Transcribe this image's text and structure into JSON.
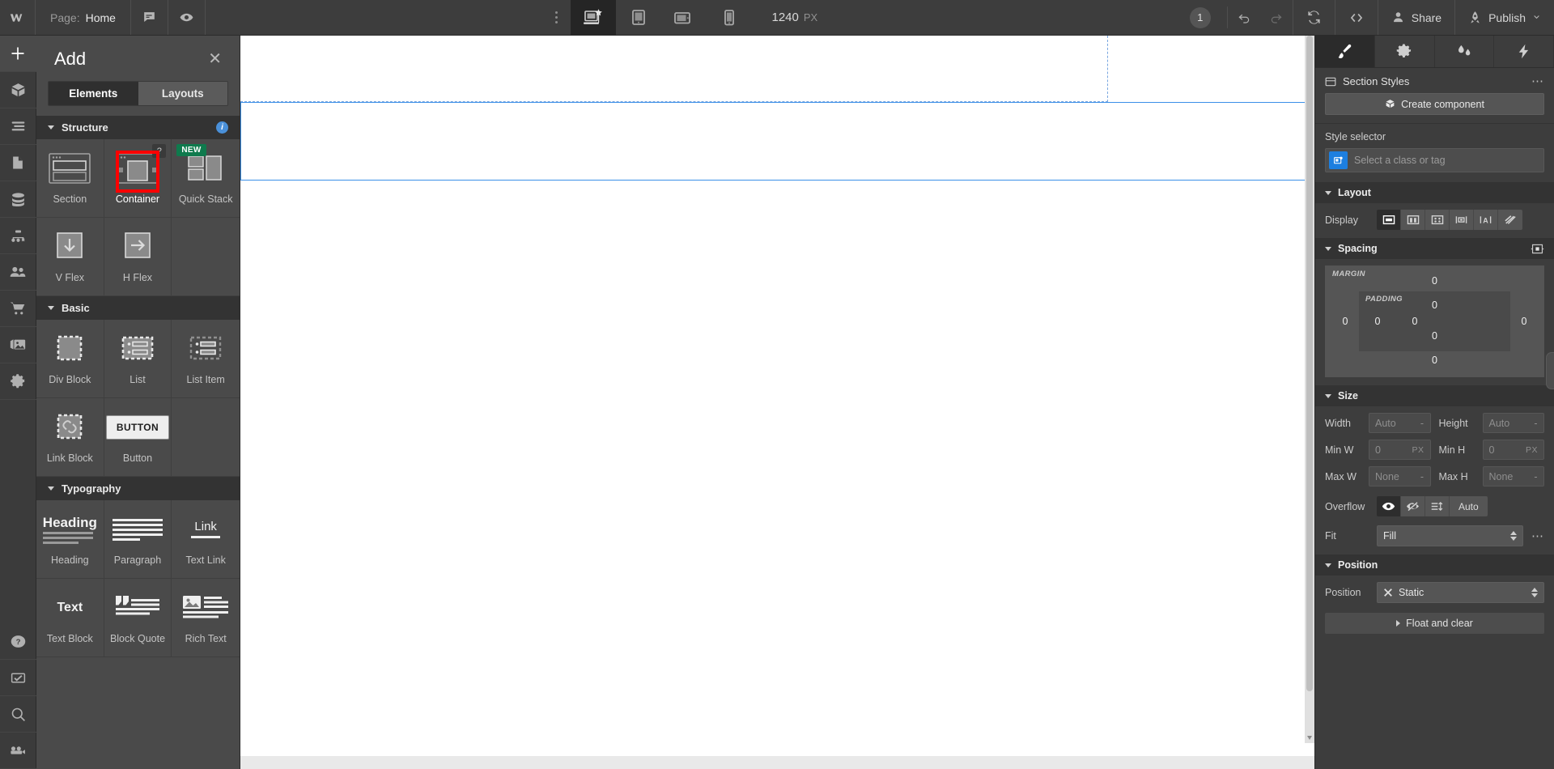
{
  "topbar": {
    "logo": "webflow-logo",
    "page_label": "Page:",
    "page_value": "Home",
    "comment_icon": "comment-icon",
    "preview_icon": "eye-icon",
    "breakpoints": [
      {
        "name": "desktop-base",
        "icon": "desktop-star-icon",
        "active": true
      },
      {
        "name": "tablet",
        "icon": "tablet-icon",
        "active": false
      },
      {
        "name": "mobile-landscape",
        "icon": "mobile-landscape-icon",
        "active": false
      },
      {
        "name": "mobile-portrait",
        "icon": "mobile-portrait-icon",
        "active": false
      }
    ],
    "viewport_width": "1240",
    "viewport_unit": "PX",
    "session_count": "1",
    "undo_icon": "undo-icon",
    "redo_icon": "redo-icon",
    "sync_icon": "refresh-icon",
    "code_icon": "code-brackets-icon",
    "share_label": "Share",
    "publish_label": "Publish"
  },
  "rail": {
    "items": [
      {
        "name": "add-panel",
        "icon": "plus-icon",
        "active": true
      },
      {
        "name": "components",
        "icon": "cube-icon",
        "active": false
      },
      {
        "name": "navigator",
        "icon": "layers-icon",
        "active": false
      },
      {
        "name": "pages",
        "icon": "page-icon",
        "active": false
      },
      {
        "name": "cms",
        "icon": "database-icon",
        "active": false
      },
      {
        "name": "logic",
        "icon": "flow-icon",
        "active": false
      },
      {
        "name": "users",
        "icon": "users-icon",
        "active": false
      },
      {
        "name": "ecommerce",
        "icon": "cart-icon",
        "active": false
      },
      {
        "name": "assets",
        "icon": "images-icon",
        "active": false
      },
      {
        "name": "settings",
        "icon": "gear-icon",
        "active": false
      }
    ],
    "bottom_items": [
      {
        "name": "help",
        "icon": "question-circle-icon"
      },
      {
        "name": "audit",
        "icon": "checkbox-icon"
      },
      {
        "name": "search",
        "icon": "magnifier-icon"
      },
      {
        "name": "video",
        "icon": "video-camera-icon"
      }
    ]
  },
  "add_panel": {
    "title": "Add",
    "close_icon": "close-icon",
    "tabs": [
      {
        "label": "Elements",
        "active": true
      },
      {
        "label": "Layouts",
        "active": false
      }
    ],
    "sections": [
      {
        "title": "Structure",
        "has_info": true,
        "items": [
          {
            "label": "Section",
            "icon": "section-icon",
            "badge": null,
            "selected": false
          },
          {
            "label": "Container",
            "icon": "container-icon",
            "badge": "?",
            "selected": true,
            "highlight": true
          },
          {
            "label": "Quick Stack",
            "icon": "quick-stack-icon",
            "badge": "NEW",
            "selected": false
          },
          {
            "label": "V Flex",
            "icon": "arrow-down-icon",
            "badge": null,
            "selected": false
          },
          {
            "label": "H Flex",
            "icon": "arrow-right-icon",
            "badge": null,
            "selected": false
          }
        ]
      },
      {
        "title": "Basic",
        "has_info": false,
        "items": [
          {
            "label": "Div Block",
            "icon": "div-block-icon",
            "badge": null,
            "selected": false
          },
          {
            "label": "List",
            "icon": "list-icon",
            "badge": null,
            "selected": false
          },
          {
            "label": "List Item",
            "icon": "list-item-icon",
            "badge": null,
            "selected": false
          },
          {
            "label": "Link Block",
            "icon": "link-chain-icon",
            "badge": null,
            "selected": false
          },
          {
            "label": "Button",
            "icon": "button-icon",
            "badge": null,
            "selected": false
          }
        ]
      },
      {
        "title": "Typography",
        "has_info": false,
        "items": [
          {
            "label": "Heading",
            "icon": "heading-icon",
            "badge": null,
            "selected": false
          },
          {
            "label": "Paragraph",
            "icon": "paragraph-icon",
            "badge": null,
            "selected": false
          },
          {
            "label": "Text Link",
            "icon": "text-link-icon",
            "badge": null,
            "selected": false
          },
          {
            "label": "Text Block",
            "icon": "text-block-icon",
            "badge": null,
            "selected": false
          },
          {
            "label": "Block Quote",
            "icon": "block-quote-icon",
            "badge": null,
            "selected": false
          },
          {
            "label": "Rich Text",
            "icon": "rich-text-icon",
            "badge": null,
            "selected": false
          }
        ]
      }
    ],
    "button_element_text": "BUTTON",
    "heading_element_text": "Heading",
    "link_element_text": "Link",
    "text_element_text": "Text"
  },
  "style_panel": {
    "tabs": [
      {
        "name": "style",
        "icon": "paint-brush-icon",
        "active": true
      },
      {
        "name": "settings",
        "icon": "gear-icon",
        "active": false
      },
      {
        "name": "interactions",
        "icon": "droplets-icon",
        "active": false
      },
      {
        "name": "effects",
        "icon": "lightning-icon",
        "active": false
      }
    ],
    "element_title": "Section Styles",
    "element_icon": "section-icon",
    "menu_icon": "more-dots-icon",
    "create_component_label": "Create component",
    "create_component_icon": "cube-icon",
    "style_selector_label": "Style selector",
    "style_selector_placeholder": "Select a class or tag",
    "layout": {
      "title": "Layout",
      "display_label": "Display",
      "display_options": [
        {
          "name": "block",
          "icon": "display-block-icon",
          "active": true
        },
        {
          "name": "flex",
          "icon": "display-flex-icon",
          "active": false
        },
        {
          "name": "grid",
          "icon": "display-grid-icon",
          "active": false
        },
        {
          "name": "inline-block",
          "icon": "display-inline-block-icon",
          "active": false
        },
        {
          "name": "inline",
          "icon": "display-inline-icon",
          "active": false
        },
        {
          "name": "none",
          "icon": "display-none-icon",
          "active": false
        }
      ]
    },
    "spacing": {
      "title": "Spacing",
      "toggle_icon": "spacing-expand-icon",
      "margin_label": "MARGIN",
      "padding_label": "PADDING",
      "margin_top": "0",
      "margin_right": "0",
      "margin_bottom": "0",
      "margin_left": "0",
      "padding_top": "0",
      "padding_right": "0",
      "padding_bottom": "0",
      "padding_left": "0"
    },
    "size": {
      "title": "Size",
      "fields": [
        {
          "label": "Width",
          "value": "Auto",
          "unit": "-"
        },
        {
          "label": "Height",
          "value": "Auto",
          "unit": "-"
        },
        {
          "label": "Min W",
          "value": "0",
          "unit": "PX"
        },
        {
          "label": "Min H",
          "value": "0",
          "unit": "PX"
        },
        {
          "label": "Max W",
          "value": "None",
          "unit": "-"
        },
        {
          "label": "Max H",
          "value": "None",
          "unit": "-"
        }
      ],
      "overflow_label": "Overflow",
      "overflow_options": [
        {
          "name": "visible",
          "icon": "eye-icon",
          "active": true
        },
        {
          "name": "hidden",
          "icon": "eye-off-icon",
          "active": false
        },
        {
          "name": "scroll",
          "icon": "scroll-icon",
          "active": false
        },
        {
          "name": "auto",
          "icon": null,
          "label": "Auto",
          "active": false
        }
      ],
      "fit_label": "Fit",
      "fit_value": "Fill",
      "fit_menu_icon": "more-dots-icon"
    },
    "position": {
      "title": "Position",
      "label": "Position",
      "value": "Static",
      "clear_icon": "close-x-icon",
      "float_label": "Float and clear"
    }
  }
}
